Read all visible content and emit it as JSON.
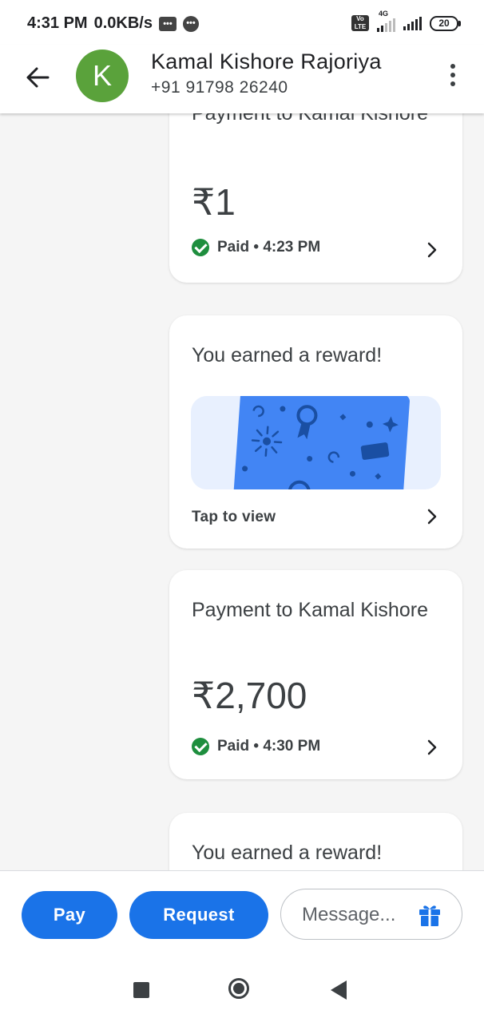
{
  "status_bar": {
    "time": "4:31 PM",
    "speed": "0.0KB/s",
    "network": "4G",
    "volte": "Vo LTE",
    "battery": "20"
  },
  "header": {
    "avatar_letter": "K",
    "contact_name": "Kamal Kishore Rajoriya",
    "phone": "+91 91798 26240"
  },
  "feed": {
    "payment1": {
      "title": "Payment to Kamal Kishore",
      "amount": "₹1",
      "status": "Paid • 4:23 PM"
    },
    "reward1": {
      "title": "You earned a reward!",
      "action": "Tap to view"
    },
    "payment2": {
      "title": "Payment to Kamal Kishore",
      "amount": "₹2,700",
      "status": "Paid • 4:30 PM"
    },
    "reward2": {
      "title": "You earned a reward!"
    }
  },
  "actions": {
    "pay_label": "Pay",
    "request_label": "Request",
    "message_placeholder": "Message..."
  },
  "colors": {
    "primary": "#1a73e8",
    "success": "#1e8e3e",
    "avatar": "#5aa23b",
    "reward_card": "#4285f4"
  }
}
